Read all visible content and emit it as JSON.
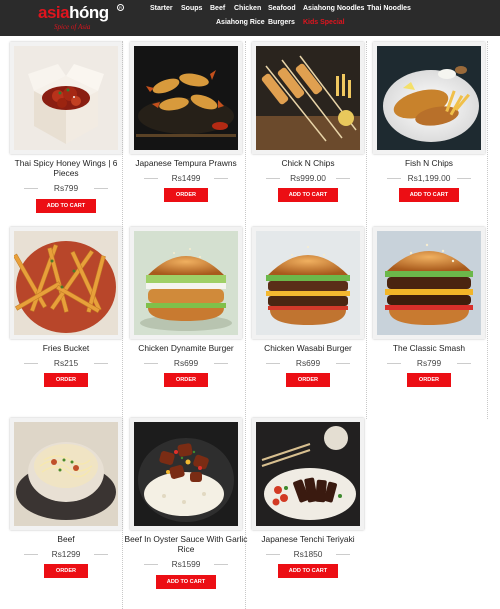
{
  "brand": {
    "name_red": "asia",
    "name_white": "hóng",
    "tagline": "Spice of Asia"
  },
  "nav": {
    "row1": [
      "Starter",
      "Soups",
      "Beef",
      "Chicken",
      "Seafood",
      "Asiahong Noodles",
      "Thai Noodles"
    ],
    "row2": [
      "Asiahong Rice",
      "Burgers",
      "Kids Special"
    ],
    "active": "Kids Special"
  },
  "products": [
    {
      "name": "Thai Spicy Honey Wings | 6 Pieces",
      "price": "Rs799",
      "button": "ADD TO CART",
      "image": "wings-box-photo"
    },
    {
      "name": "Japanese Tempura Prawns",
      "price": "Rs1499",
      "button": "ORDER",
      "image": "tempura-prawns-photo"
    },
    {
      "name": "Chick N Chips",
      "price": "Rs999.00",
      "button": "ADD TO CART",
      "image": "chicken-skewers-photo"
    },
    {
      "name": "Fish N Chips",
      "price": "Rs1,199.00",
      "button": "ADD TO CART",
      "image": "fish-and-chips-photo"
    },
    {
      "name": "Fries Bucket",
      "price": "Rs215",
      "button": "ORDER",
      "image": "fries-photo"
    },
    {
      "name": "Chicken Dynamite Burger",
      "price": "Rs699",
      "button": "ORDER",
      "image": "chicken-burger-photo"
    },
    {
      "name": "Chicken Wasabi Burger",
      "price": "Rs699",
      "button": "ORDER",
      "image": "wasabi-burger-photo"
    },
    {
      "name": "The Classic Smash",
      "price": "Rs799",
      "button": "ORDER",
      "image": "smash-burger-photo"
    },
    {
      "name": "Beef",
      "price": "Rs1299",
      "button": "ORDER",
      "image": "beef-noodle-soup-photo"
    },
    {
      "name": "Beef In Oyster Sauce With Garlic Rice",
      "price": "Rs1599",
      "button": "ADD TO CART",
      "image": "beef-rice-photo"
    },
    {
      "name": "Japanese Tenchi Teriyaki",
      "price": "Rs1850",
      "button": "ADD TO CART",
      "image": "teriyaki-plate-photo"
    }
  ],
  "colors": {
    "header_bg": "#2b2b2b",
    "accent_red": "#ec0e14",
    "active_nav": "#e0141e"
  }
}
